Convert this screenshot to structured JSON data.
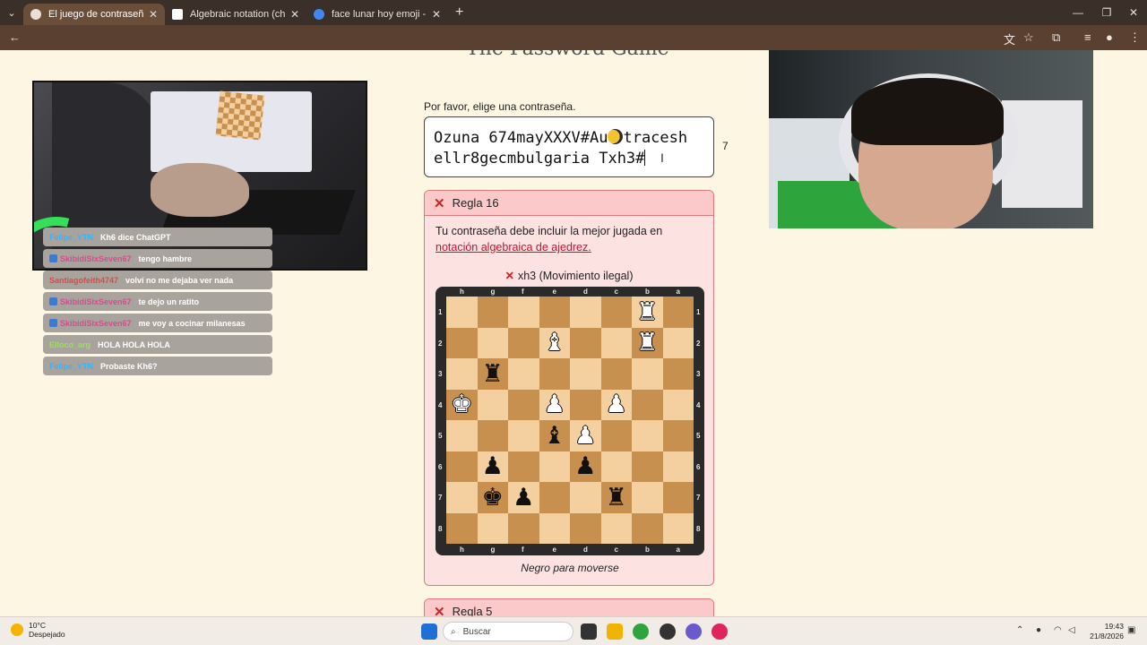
{
  "browser": {
    "tabs": [
      {
        "label": "El juego de contraseñas",
        "active": true,
        "favicon_color": "#e8e0d8"
      },
      {
        "label": "Algebraic notation (chess) - Wi",
        "active": false,
        "favicon_color": "#ffffff"
      },
      {
        "label": "face lunar hoy emoji - Buscar c",
        "active": false,
        "favicon_color": "#4285f4"
      }
    ],
    "new_tab": "+",
    "close_glyph": "✕"
  },
  "page": {
    "title_partial": "The Password Game",
    "prompt": "Por favor, elige una contraseña.",
    "password_line1_a": "Ozuna 674mayXXXV#Au",
    "password_line1_b": "tracesh",
    "password_line2": "ellr8gecmbulgaria Txh3#",
    "char_count": "7",
    "moon_icon": "crescent-moon-emoji-icon"
  },
  "rule16": {
    "title": "Regla 16",
    "text": "Tu contraseña debe incluir la mejor jugada en ",
    "link": "notación algebraica de ajedrez.",
    "verdict": "xh3 (Movimiento ilegal)",
    "to_move": "Negro para moverse"
  },
  "rule5": {
    "title": "Regla 5"
  },
  "board": {
    "files": [
      "h",
      "g",
      "f",
      "e",
      "d",
      "c",
      "b",
      "a"
    ],
    "ranks": [
      "1",
      "2",
      "3",
      "4",
      "5",
      "6",
      "7",
      "8"
    ],
    "rows": [
      [
        "",
        "",
        "",
        "",
        "",
        "",
        "wR",
        ""
      ],
      [
        "",
        "",
        "",
        "wB",
        "",
        "",
        "wR",
        ""
      ],
      [
        "",
        "bR",
        "",
        "",
        "",
        "",
        "",
        ""
      ],
      [
        "wK",
        "",
        "",
        "wP",
        "",
        "wP",
        "",
        ""
      ],
      [
        "",
        "",
        "",
        "bB",
        "wP",
        "",
        "",
        ""
      ],
      [
        "",
        "bP",
        "",
        "",
        "bP",
        "",
        "",
        ""
      ],
      [
        "",
        "bK",
        "bP",
        "",
        "",
        "bR",
        "",
        ""
      ],
      [
        "",
        "",
        "",
        "",
        "",
        "",
        "",
        ""
      ]
    ]
  },
  "chat": [
    {
      "user": "Felipe_YTN",
      "msg": "Kh6 dice ChatGPT",
      "color": "#33b5ff",
      "badge": false
    },
    {
      "user": "SkibidiSixSeven67",
      "msg": "tengo hambre",
      "color": "#d94a8c",
      "badge": true
    },
    {
      "user": "Santiagofeith4747",
      "msg": "volví no me dejaba ver nada",
      "color": "#d94a4a",
      "badge": false
    },
    {
      "user": "SkibidiSixSeven67",
      "msg": "te dejo un ratito",
      "color": "#d94a8c",
      "badge": true
    },
    {
      "user": "SkibidiSixSeven67",
      "msg": "me voy a cocinar milanesas",
      "color": "#d94a8c",
      "badge": true
    },
    {
      "user": "Elloco_arg",
      "msg": "HOLA HOLA HOLA",
      "color": "#9be05a",
      "badge": false
    },
    {
      "user": "Felipe_YTN",
      "msg": "Probaste Kh6?",
      "color": "#33b5ff",
      "badge": false
    }
  ],
  "taskbar": {
    "temp": "10°C",
    "weather": "Despejado",
    "search_placeholder": "Buscar",
    "time": "19:43",
    "date": "21/8/2026"
  }
}
